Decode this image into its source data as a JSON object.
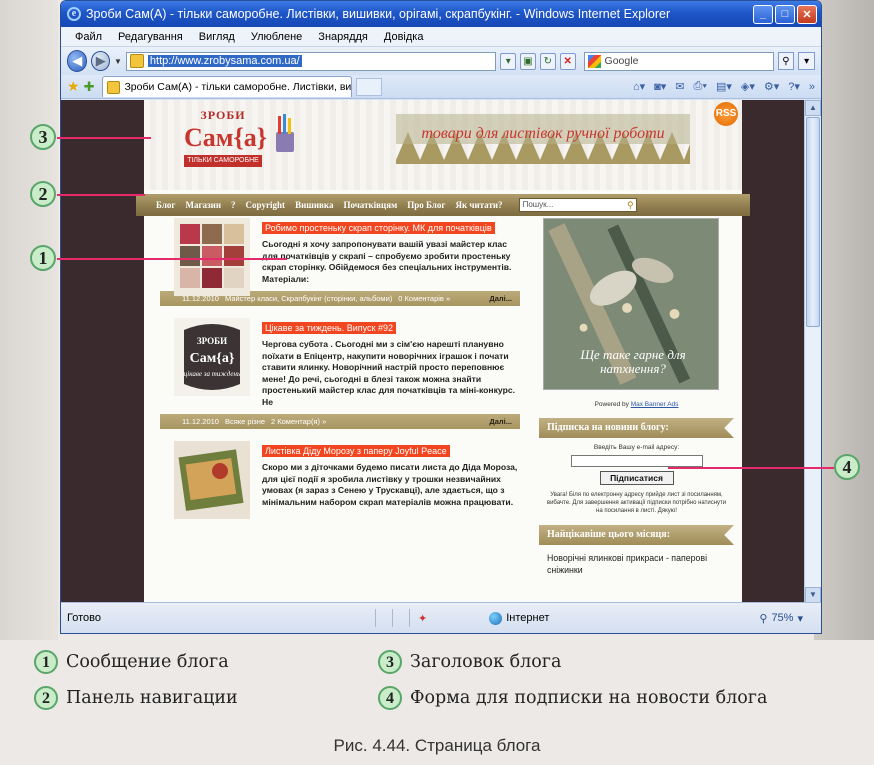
{
  "window": {
    "title": "Зроби Сам(А) - тільки саморобне. Листівки, вишивки, орігамі, скрапбукінг. - Windows Internet Explorer",
    "min": "_",
    "max": "□",
    "close": "✕"
  },
  "menu": [
    "Файл",
    "Редагування",
    "Вигляд",
    "Улюблене",
    "Знаряддя",
    "Довідка"
  ],
  "address": {
    "url": "http://www.zrobysama.com.ua/",
    "search_provider": "Google"
  },
  "tab": {
    "label": "Зроби Сам(А) - тільки саморобне. Листівки, вишив..."
  },
  "blog": {
    "logo_top": "ЗРОБИ",
    "logo_main": "Сам{а}",
    "logo_ribbon": "ТІЛЬКИ САМОРОБНЕ",
    "banner": "товари для листівок ручної роботи",
    "rss": "RSS",
    "nav": [
      "Блог",
      "Магазин",
      "?",
      "Copyright",
      "Вишивка",
      "Початківцям",
      "Про Блог",
      "Як читати?"
    ],
    "search_placeholder": "Пошук...",
    "posts": [
      {
        "title": "Робимо простеньку скрап сторінку. МК для початківців",
        "text": "Сьогодні я хочу запропонувати вашій увазі майстер клас для початківців у скрапі – спробуємо зробити простеньку скрап сторінку. Обійдемося без спеціальних інструментів. Матеріали:",
        "date": "11.12.2010",
        "categories": "Майстер класи, Скрапбукінг (сторінки, альбоми)",
        "comments": "0 Коментарів »",
        "more": "Далі..."
      },
      {
        "title": "Цікаве за тиждень. Випуск #92",
        "text": "Чергова субота . Сьогодні ми з сім'єю нарешті планувно поїхати в Епіцентр, накупити новорічних іграшок і почати ставити ялинку. Новорічний настрій просто переповнює мене! До речі, сьогодні в блезі також можна знайти простенький майстер клас для початківців та міні-конкурс. Не",
        "date": "11.12.2010",
        "categories": "Всяке різне",
        "comments": "2 Коментар(я) »",
        "more": "Далі...",
        "thumb_top": "ЗРОБИ",
        "thumb_main": "Сам{а}",
        "thumb_sub": "цікаве за тиждень"
      },
      {
        "title": "Листівка Діду Морозу з паперу Joyful Peace",
        "text": "Скоро ми з діточками будемо писати листа до Діда Мороза, для цієї події я зробила листівку у трошки незвичайних умовах (я зараз з Сенею у Трускавці), але здається, що з мінімальним набором скрап матеріалів можна працювати."
      }
    ],
    "sidebar": {
      "image_caption": "Ще таке гарне для натхнення?",
      "powered_prefix": "Powered by",
      "powered_link": "Max Banner Ads",
      "subscribe_title": "Підписка на новини блогу:",
      "subscribe_label": "Введіть Вашу e-mail адресу:",
      "subscribe_button": "Підписатися",
      "subscribe_note": "Увага! Біля по електронну адресу прийде лист зі посиланням, вибачте. Для завершення активації підписки потрібно натиснути на посилання в листі. Дякую!",
      "popular_title": "Найцікавіше цього місяця:",
      "popular_item": "Новорічні ялинкові прикраси - паперові сніжинки"
    }
  },
  "status": {
    "ready": "Готово",
    "zone": "Інтернет",
    "zoom": "75%"
  },
  "callouts": [
    "3",
    "2",
    "1",
    "4"
  ],
  "legend": {
    "items": [
      {
        "num": "1",
        "text": "Сообщение блога"
      },
      {
        "num": "2",
        "text": "Панель навигации"
      },
      {
        "num": "3",
        "text": "Заголовок блога"
      },
      {
        "num": "4",
        "text": "Форма для подписки на новости блога"
      }
    ],
    "caption": "Рис. 4.44. Страница блога"
  }
}
